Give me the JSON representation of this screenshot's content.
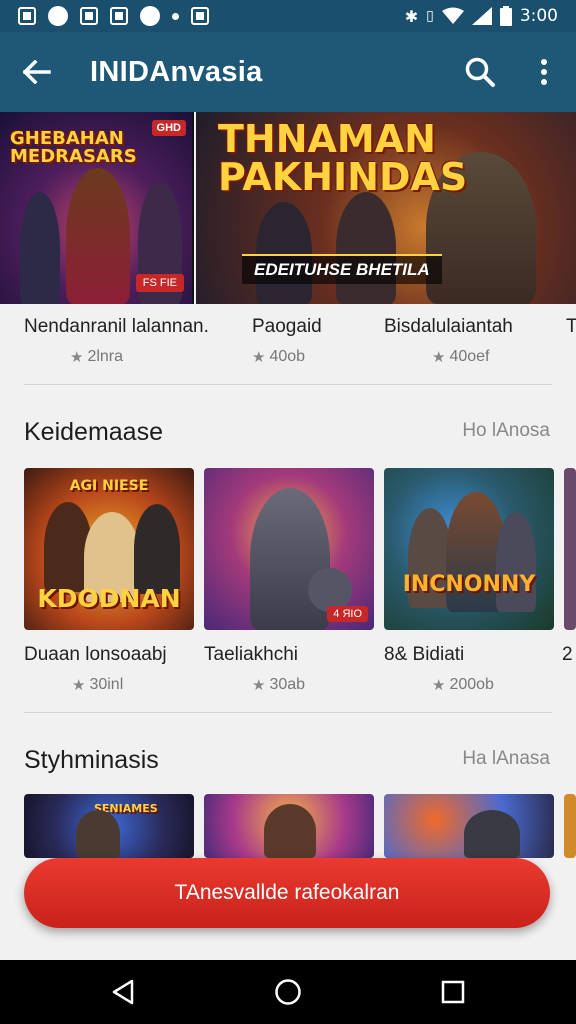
{
  "status_bar": {
    "time": "3:00",
    "icons": [
      "sim-icon",
      "chat-icon",
      "save-icon",
      "photo-icon",
      "compass-icon",
      "dot-icon",
      "flag-icon",
      "bluetooth-icon",
      "vibrate-icon",
      "wifi-icon",
      "signal-icon",
      "battery-icon"
    ]
  },
  "app_bar": {
    "title": "INIDAnvasia"
  },
  "hero": {
    "slide1": {
      "logo": "GHEBAHAN MEDRASARS",
      "tag": "GHD",
      "badge": "FS FIE"
    },
    "slide2": {
      "logo": "THNAMAN PAKHINDAS",
      "caption": "EDEITUHSE BHETILA"
    }
  },
  "featured_row": [
    {
      "name": "Nendanranil lalannan.",
      "rating": "2lnra"
    },
    {
      "name": "Paogaid",
      "rating": "40ob"
    },
    {
      "name": "Bisdalulaiantah",
      "rating": "40oef"
    },
    {
      "name": "T",
      "rating": ""
    }
  ],
  "section1": {
    "title": "Keidemaase",
    "more": "Ho lAnosa",
    "items": [
      {
        "name": "Duaan lonsoaabj",
        "rating": "30inl",
        "logo_top": "AGI NIESE",
        "logo_bottom": "KDODNAN"
      },
      {
        "name": "Taeliakhchi",
        "rating": "30ab",
        "tag": "4 ЯIO"
      },
      {
        "name": "Bidiati",
        "prefix": "8&",
        "rating": "200ob",
        "logo": "INCNONNY"
      },
      {
        "name": "2",
        "rating": ""
      }
    ]
  },
  "section2": {
    "title": "Styhminasis",
    "more": "Ha lAnasa",
    "items": [
      {
        "logo": "SENIAMES"
      },
      {},
      {},
      {}
    ]
  },
  "cta": {
    "label": "TAnesvallde rafeokalran"
  },
  "colors": {
    "app_bar": "#1f5877",
    "status_bar": "#1b4f6e",
    "cta": "#d62b22",
    "nav": "#000000"
  }
}
